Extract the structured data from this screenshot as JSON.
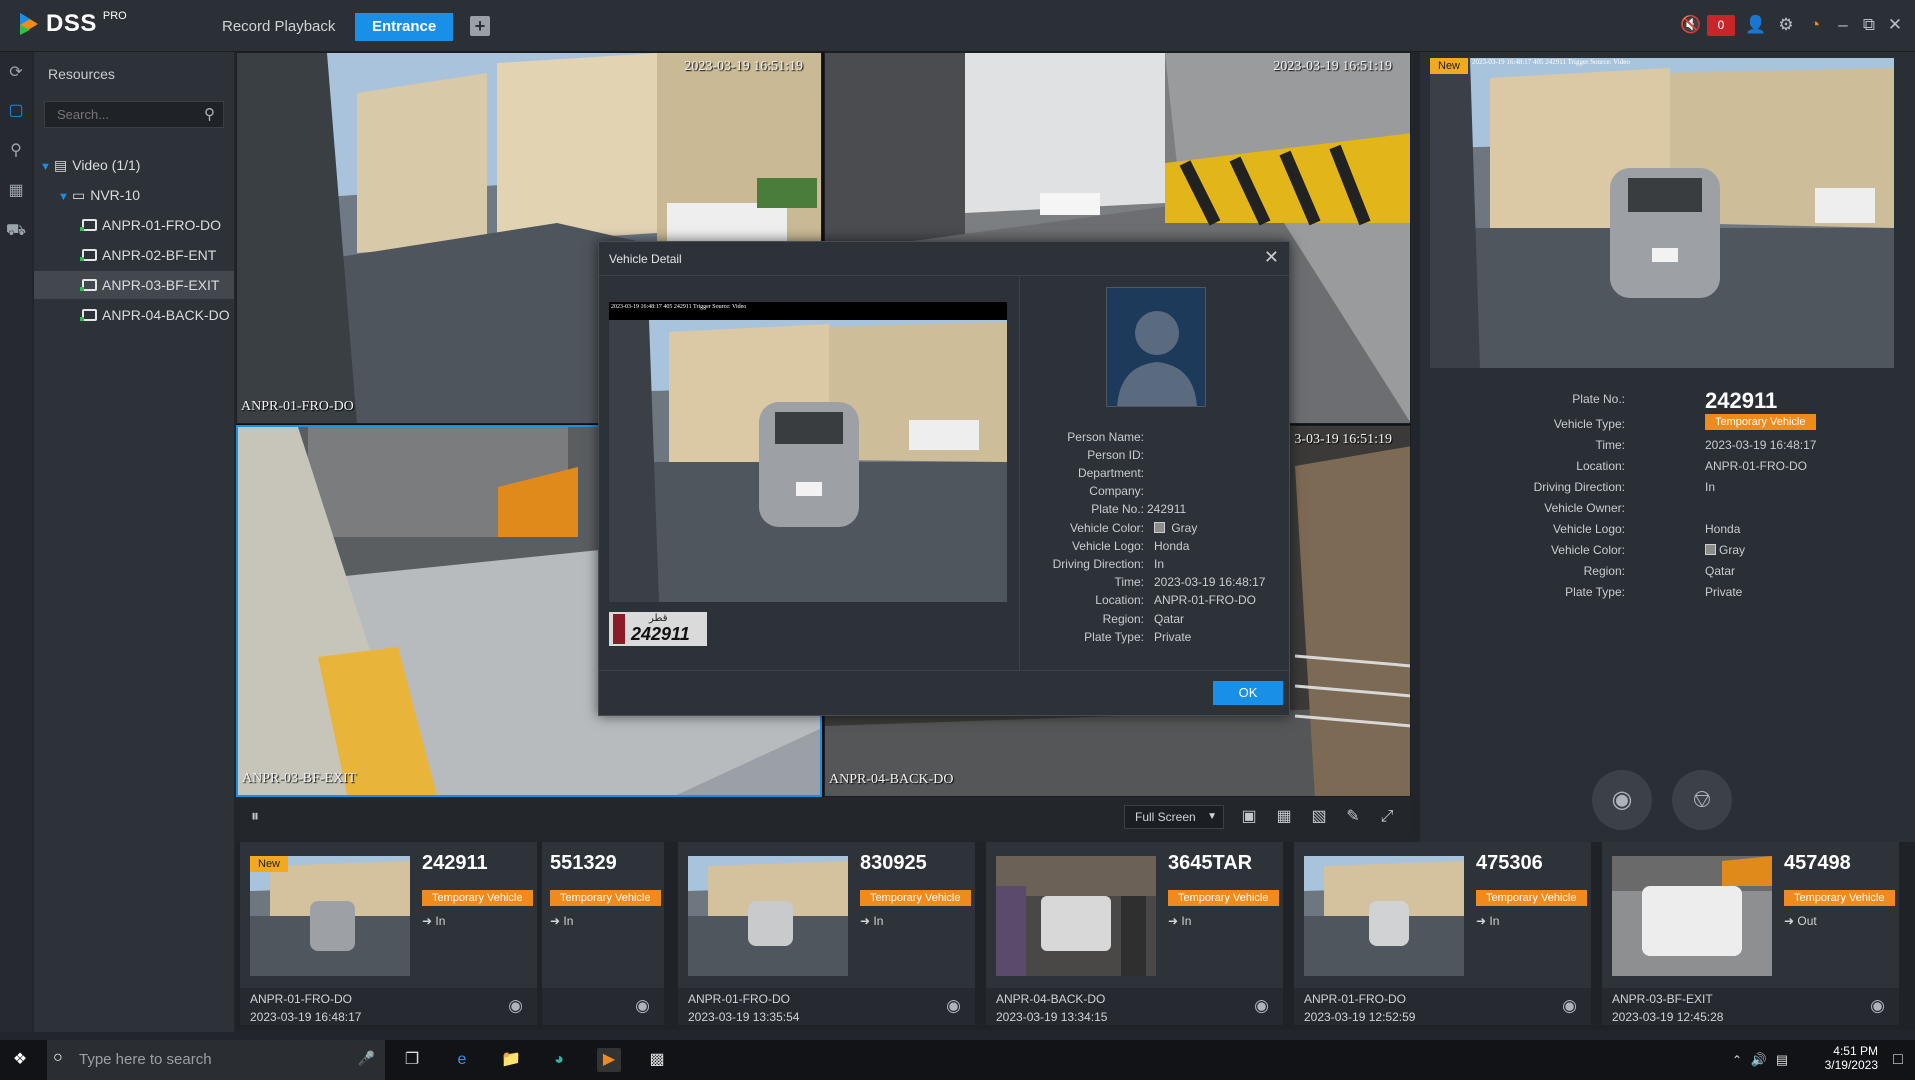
{
  "app": {
    "brand": "DSS",
    "brand_suffix": "PRO",
    "tabs": [
      {
        "label": "Record Playback",
        "active": false
      },
      {
        "label": "Entrance",
        "active": true
      }
    ],
    "add_tab_label": "+",
    "alarm_count": "0",
    "accent_color": "#1a8fe8",
    "tag_color": "#f08a1c"
  },
  "resources": {
    "title": "Resources",
    "search_placeholder": "Search...",
    "tree": [
      {
        "label": "Video (1/1)",
        "level": 0
      },
      {
        "label": "NVR-10",
        "level": 1
      },
      {
        "label": "ANPR-01-FRO-DO",
        "level": 2
      },
      {
        "label": "ANPR-02-BF-ENT",
        "level": 2
      },
      {
        "label": "ANPR-03-BF-EXIT",
        "level": 2,
        "selected": true
      },
      {
        "label": "ANPR-04-BACK-DO",
        "level": 2
      }
    ]
  },
  "video": {
    "cells": [
      {
        "timestamp": "2023-03-19 16:51:19",
        "label": "ANPR-01-FRO-DO"
      },
      {
        "timestamp": "2023-03-19 16:51:19",
        "label": ""
      },
      {
        "timestamp": "",
        "label": "ANPR-03-BF-EXIT"
      },
      {
        "timestamp": "3-03-19 16:51:19",
        "label": "ANPR-04-BACK-DO"
      }
    ],
    "toolbar": {
      "screen_mode": "Full Screen"
    }
  },
  "detail_panel": {
    "new_label": "New",
    "snapshot_caption": "2023-03-19 16:48:17 405 242911 Trigger Source: Video",
    "plate_no_label": "Plate No.:",
    "plate_no": "242911",
    "rows": [
      {
        "label": "Vehicle Type:",
        "value": "Temporary Vehicle",
        "tag": true
      },
      {
        "label": "Time:",
        "value": "2023-03-19 16:48:17"
      },
      {
        "label": "Location:",
        "value": "ANPR-01-FRO-DO"
      },
      {
        "label": "Driving Direction:",
        "value": "In"
      },
      {
        "label": "Vehicle Owner:",
        "value": ""
      },
      {
        "label": "Vehicle Logo:",
        "value": "Honda"
      },
      {
        "label": "Vehicle Color:",
        "value": "Gray",
        "swatch": true
      },
      {
        "label": "Region:",
        "value": "Qatar"
      },
      {
        "label": "Plate Type:",
        "value": "Private"
      }
    ]
  },
  "modal": {
    "title": "Vehicle Detail",
    "close_icon": "close-icon",
    "snapshot_caption": "2023-03-19 16:48:17 405 242911 Trigger Source: Video",
    "plate_crop_text": "242911",
    "plate_crop_top": "قطر",
    "rows": [
      {
        "label": "Person Name:",
        "value": ""
      },
      {
        "label": "Person ID:",
        "value": ""
      },
      {
        "label": "Department:",
        "value": ""
      },
      {
        "label": "Company:",
        "value": ""
      },
      {
        "label": "Plate No.:",
        "value": "242911"
      },
      {
        "label": "Vehicle Color:",
        "value": "Gray",
        "swatch": true
      },
      {
        "label": "Vehicle Logo:",
        "value": "Honda"
      },
      {
        "label": "Driving Direction:",
        "value": "In"
      },
      {
        "label": "Time:",
        "value": "2023-03-19 16:48:17"
      },
      {
        "label": "Location:",
        "value": "ANPR-01-FRO-DO"
      },
      {
        "label": "Region:",
        "value": "Qatar"
      },
      {
        "label": "Plate Type:",
        "value": "Private"
      }
    ],
    "ok_label": "OK"
  },
  "captures": [
    {
      "plate": "242911",
      "type": "Temporary Vehicle",
      "direction": "In",
      "location": "ANPR-01-FRO-DO",
      "time": "2023-03-19 16:48:17",
      "new": "New",
      "has_thumb": true
    },
    {
      "plate": "551329",
      "type": "Temporary Vehicle",
      "direction": "In",
      "location": "",
      "time": "",
      "new": "",
      "has_thumb": false
    },
    {
      "plate": "830925",
      "type": "Temporary Vehicle",
      "direction": "In",
      "location": "ANPR-01-FRO-DO",
      "time": "2023-03-19 13:35:54",
      "new": "",
      "has_thumb": true
    },
    {
      "plate": "3645TAR",
      "type": "Temporary Vehicle",
      "direction": "In",
      "location": "ANPR-04-BACK-DO",
      "time": "2023-03-19 13:34:15",
      "new": "",
      "has_thumb": true
    },
    {
      "plate": "475306",
      "type": "Temporary Vehicle",
      "direction": "In",
      "location": "ANPR-01-FRO-DO",
      "time": "2023-03-19 12:52:59",
      "new": "",
      "has_thumb": true
    },
    {
      "plate": "457498",
      "type": "Temporary Vehicle",
      "direction": "Out",
      "location": "ANPR-03-BF-EXIT",
      "time": "2023-03-19 12:45:28",
      "new": "",
      "has_thumb": true
    }
  ],
  "taskbar": {
    "search_placeholder": "Type here to search",
    "time": "4:51 PM",
    "date": "3/19/2023"
  }
}
